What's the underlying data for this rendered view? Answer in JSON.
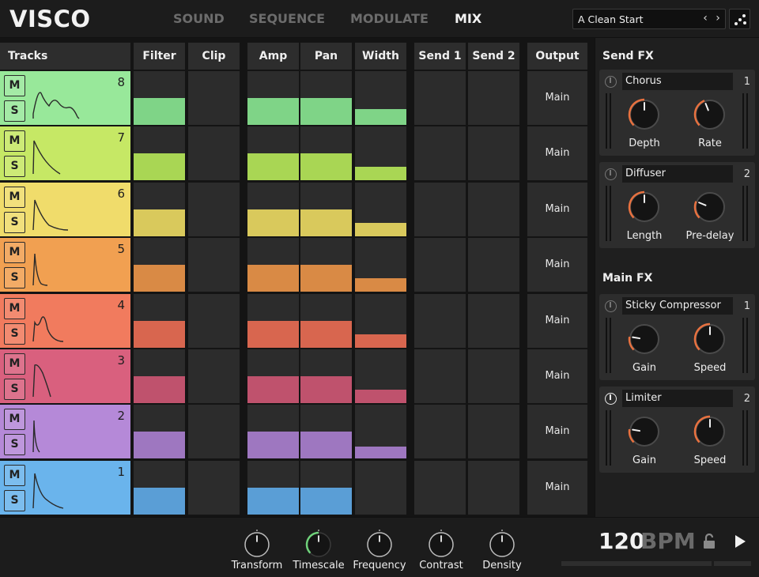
{
  "app": {
    "logo": "VISCO"
  },
  "nav": {
    "tabs": [
      {
        "label": "SOUND",
        "active": false
      },
      {
        "label": "SEQUENCE",
        "active": false
      },
      {
        "label": "MODULATE",
        "active": false
      },
      {
        "label": "MIX",
        "active": true
      }
    ]
  },
  "preset": {
    "name": "A Clean Start",
    "prev_icon": "chevron-left-icon",
    "next_icon": "chevron-right-icon",
    "randomize_icon": "dice-icon"
  },
  "mixer": {
    "tracks_header": "Tracks",
    "columns": [
      "Filter",
      "Clip",
      "Amp",
      "Pan",
      "Width",
      "Send 1",
      "Send 2",
      "Output"
    ],
    "mute_label": "M",
    "solo_label": "S",
    "tracks": [
      {
        "number": "8",
        "color": "#98e89a",
        "fill_color": "#7fd487",
        "filter": 0.5,
        "clip": 0,
        "amp": 0.5,
        "pan": 0.5,
        "width": 0.3,
        "send1": 0,
        "send2": 0,
        "output": "Main"
      },
      {
        "number": "7",
        "color": "#c6e865",
        "fill_color": "#a9d654",
        "filter": 0.5,
        "clip": 0,
        "amp": 0.5,
        "pan": 0.5,
        "width": 0.25,
        "send1": 0,
        "send2": 0,
        "output": "Main"
      },
      {
        "number": "6",
        "color": "#f0dc6b",
        "fill_color": "#d9c95c",
        "filter": 0.5,
        "clip": 0,
        "amp": 0.5,
        "pan": 0.5,
        "width": 0.25,
        "send1": 0,
        "send2": 0,
        "output": "Main"
      },
      {
        "number": "5",
        "color": "#f1a051",
        "fill_color": "#d98a45",
        "filter": 0.5,
        "clip": 0,
        "amp": 0.5,
        "pan": 0.5,
        "width": 0.25,
        "send1": 0,
        "send2": 0,
        "output": "Main"
      },
      {
        "number": "4",
        "color": "#f17b5e",
        "fill_color": "#d8664f",
        "filter": 0.5,
        "clip": 0,
        "amp": 0.5,
        "pan": 0.5,
        "width": 0.25,
        "send1": 0,
        "send2": 0,
        "output": "Main"
      },
      {
        "number": "3",
        "color": "#d9607e",
        "fill_color": "#bf526d",
        "filter": 0.5,
        "clip": 0,
        "amp": 0.5,
        "pan": 0.5,
        "width": 0.25,
        "send1": 0,
        "send2": 0,
        "output": "Main"
      },
      {
        "number": "2",
        "color": "#b589d8",
        "fill_color": "#9e77c0",
        "filter": 0.5,
        "clip": 0,
        "amp": 0.5,
        "pan": 0.5,
        "width": 0.22,
        "send1": 0,
        "send2": 0,
        "output": "Main"
      },
      {
        "number": "1",
        "color": "#6ab4ec",
        "fill_color": "#5a9ed6",
        "filter": 0.5,
        "clip": 0,
        "amp": 0.5,
        "pan": 0.5,
        "width": 0,
        "send1": 0,
        "send2": 0,
        "output": "Main"
      }
    ]
  },
  "fx": {
    "send_header": "Send FX",
    "main_header": "Main FX",
    "knob_accent": "#e8713f",
    "send": [
      {
        "name": "Chorus",
        "slot": "1",
        "power_on": false,
        "knobs": [
          {
            "label": "Depth",
            "value": 0.5
          },
          {
            "label": "Rate",
            "value": 0.42
          }
        ]
      },
      {
        "name": "Diffuser",
        "slot": "2",
        "power_on": false,
        "knobs": [
          {
            "label": "Length",
            "value": 0.5
          },
          {
            "label": "Pre-delay",
            "value": 0.25
          }
        ]
      }
    ],
    "main": [
      {
        "name": "Sticky Compressor",
        "slot": "1",
        "power_on": false,
        "knobs": [
          {
            "label": "Gain",
            "value": 0.2
          },
          {
            "label": "Speed",
            "value": 0.5
          }
        ]
      },
      {
        "name": "Limiter",
        "slot": "2",
        "power_on": true,
        "knobs": [
          {
            "label": "Gain",
            "value": 0.2
          },
          {
            "label": "Speed",
            "value": 0.5
          }
        ]
      }
    ]
  },
  "macros": [
    {
      "label": "Transform",
      "value": 0.5,
      "active": false
    },
    {
      "label": "Timescale",
      "value": 0.5,
      "active": true
    },
    {
      "label": "Frequency",
      "value": 0.5,
      "active": false
    },
    {
      "label": "Contrast",
      "value": 0.5,
      "active": false
    },
    {
      "label": "Density",
      "value": 0.5,
      "active": false
    }
  ],
  "transport": {
    "bpm_value": "120",
    "bpm_unit": "BPM",
    "lock_icon": "lock-icon",
    "play_icon": "play-icon",
    "macro_accent": "#6fd17a"
  }
}
